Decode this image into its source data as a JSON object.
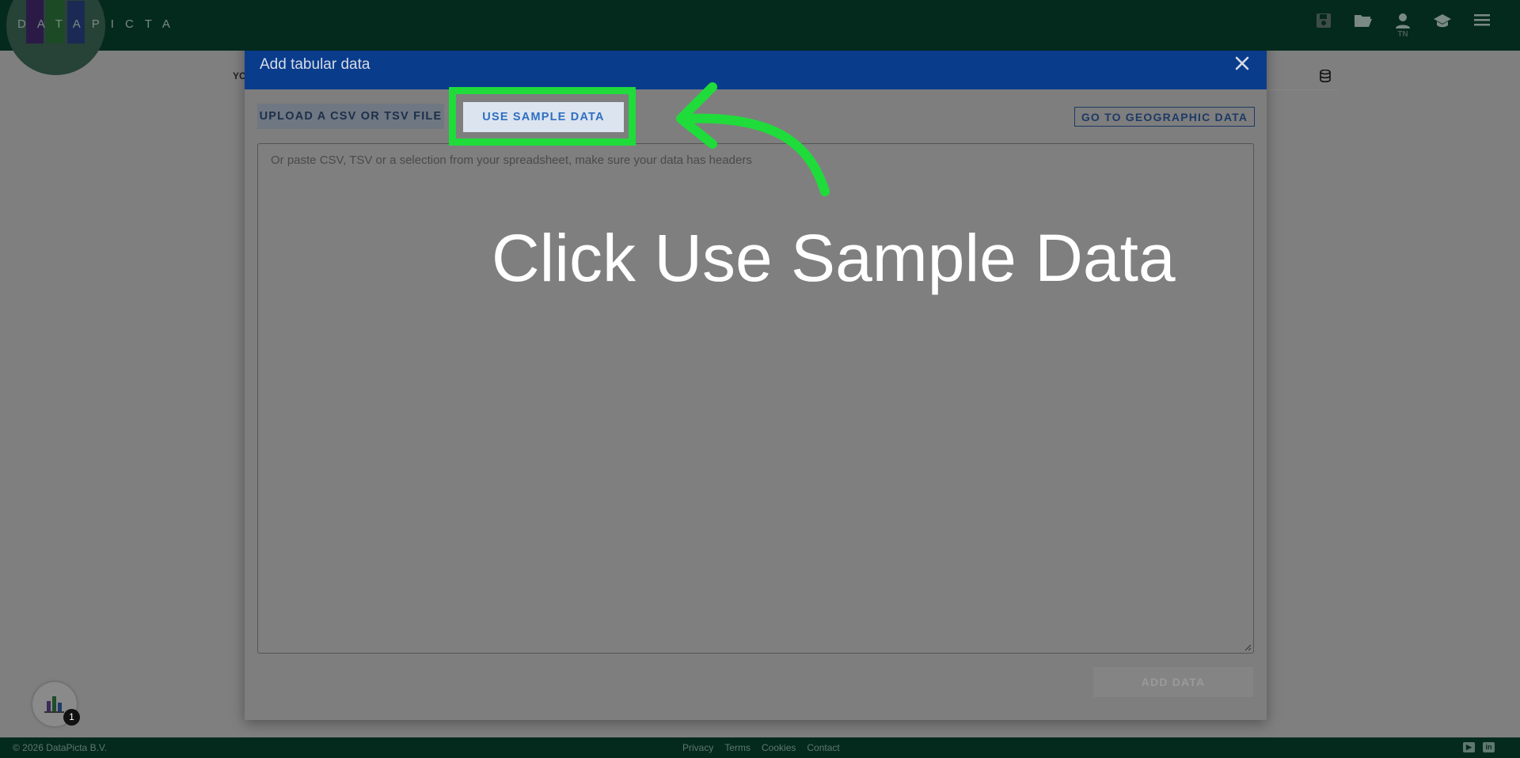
{
  "app": {
    "logo_text": "DATAPICTA",
    "logo_colors": [
      "#5b2a86",
      "#2e7d32",
      "#1e3a8a"
    ],
    "user_initials": "TN"
  },
  "topbar_icons": [
    "save-icon",
    "folder-open-icon",
    "user-icon",
    "graduation-cap-icon",
    "menu-icon"
  ],
  "behind_page": {
    "label": "YO"
  },
  "modal": {
    "title": "Add tabular data",
    "upload_button": "UPLOAD A CSV OR TSV FILE",
    "sample_button": "USE SAMPLE DATA",
    "geo_button": "GO TO GEOGRAPHIC DATA",
    "textarea_placeholder": "Or paste CSV, TSV or a selection from your spreadsheet, make sure your data has headers",
    "add_button": "ADD DATA"
  },
  "tutorial": {
    "instruction": "Click Use Sample Data",
    "highlight_color": "#1fdc3b"
  },
  "chat": {
    "badge_count": "1"
  },
  "footer": {
    "copyright": "© 2026 DataPicta B.V.",
    "links": [
      "Privacy",
      "Terms",
      "Cookies",
      "Contact"
    ]
  }
}
